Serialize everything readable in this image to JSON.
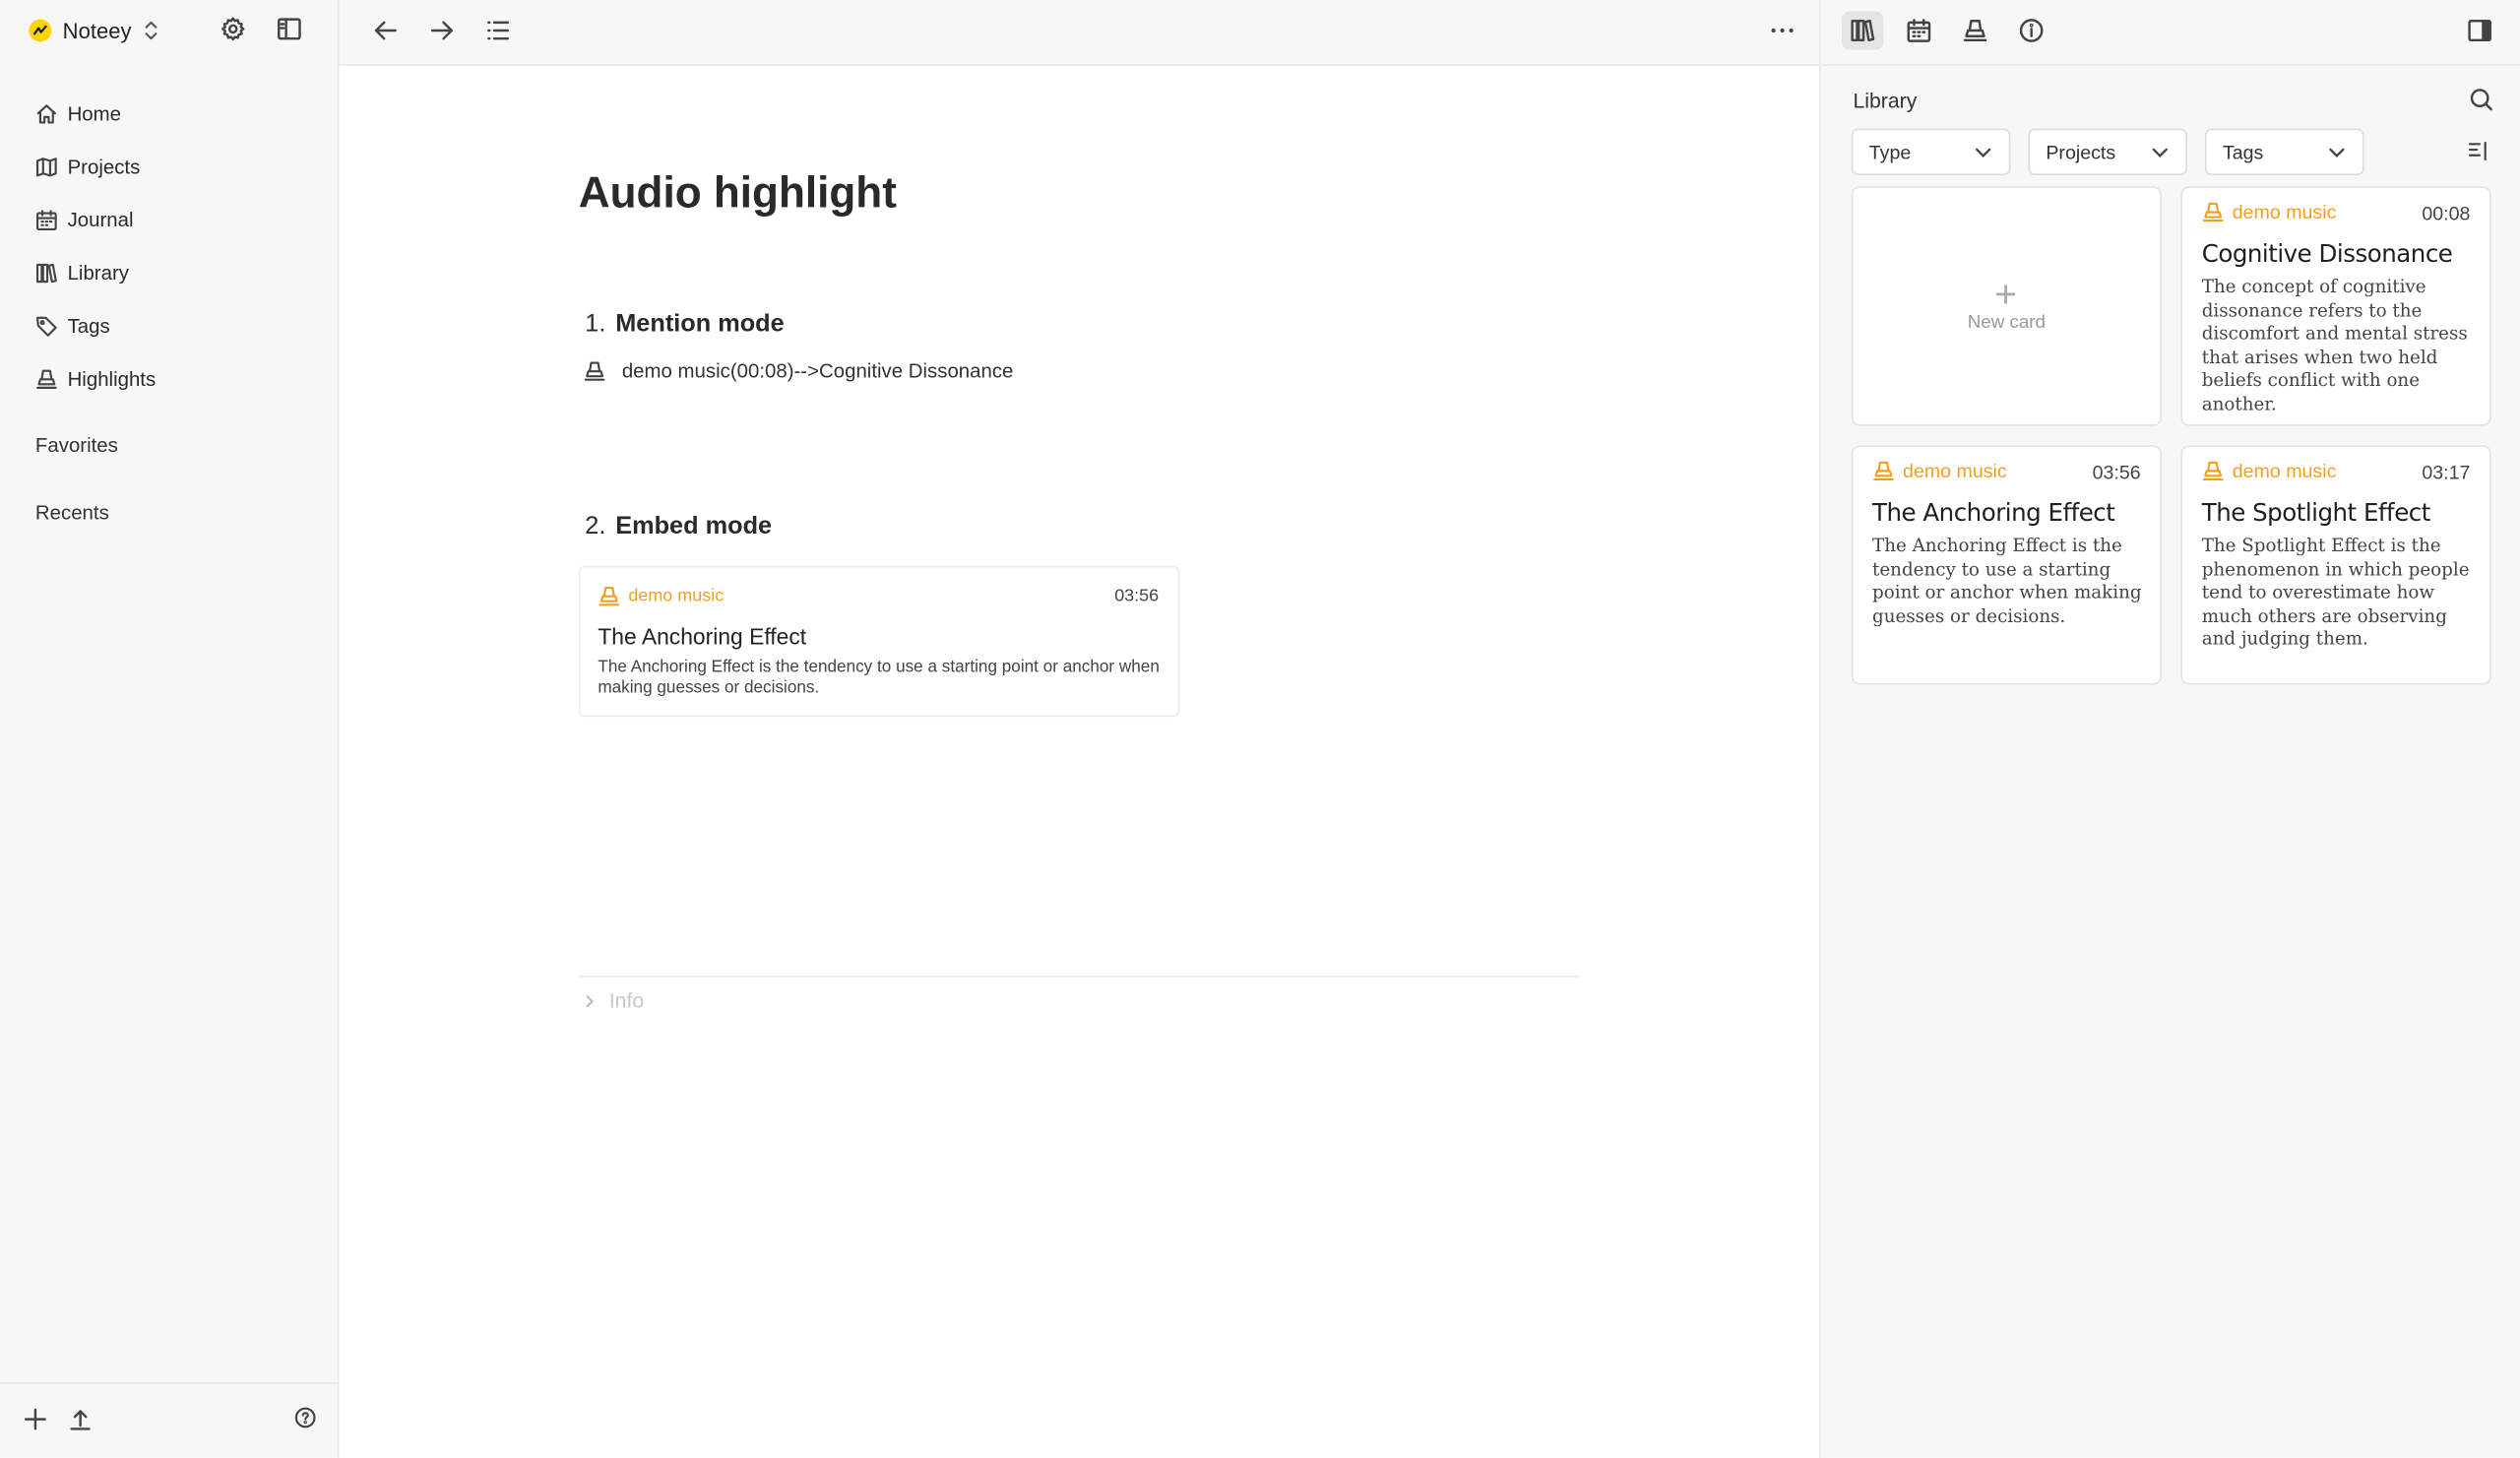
{
  "app": {
    "name": "Noteey"
  },
  "sidebar": {
    "items": [
      {
        "label": "Home",
        "icon": "home-icon"
      },
      {
        "label": "Projects",
        "icon": "map-icon"
      },
      {
        "label": "Journal",
        "icon": "calendar-icon"
      },
      {
        "label": "Library",
        "icon": "library-icon"
      },
      {
        "label": "Tags",
        "icon": "tag-icon"
      },
      {
        "label": "Highlights",
        "icon": "highlighter-icon"
      }
    ],
    "favorites_label": "Favorites",
    "recents_label": "Recents"
  },
  "document": {
    "title": "Audio highlight",
    "sections": [
      {
        "number": "1.",
        "heading": "Mention mode"
      },
      {
        "number": "2.",
        "heading": "Embed mode"
      }
    ],
    "mention_text": "demo music(00:08)-->Cognitive Dissonance",
    "embed": {
      "source": "demo music",
      "time": "03:56",
      "title": "The Anchoring Effect",
      "description": "The Anchoring Effect is the tendency to use a starting point or anchor when making guesses or decisions."
    },
    "info_label": "Info"
  },
  "library": {
    "title": "Library",
    "filters": [
      "Type",
      "Projects",
      "Tags"
    ],
    "new_card_label": "New card",
    "cards": [
      {
        "source": "demo music",
        "time": "00:08",
        "title": "Cognitive Dissonance",
        "description": "The concept of cognitive dissonance refers to the discomfort and mental stress that arises when two held beliefs conflict with one another."
      },
      {
        "source": "demo music",
        "time": "03:56",
        "title": "The Anchoring Effect",
        "description": "The Anchoring Effect is the tendency to use a starting point or anchor when making guesses or decisions."
      },
      {
        "source": "demo music",
        "time": "03:17",
        "title": "The Spotlight Effect",
        "description": "The Spotlight Effect is the phenomenon in which people tend to overestimate how much others are observing and judging them."
      }
    ]
  },
  "colors": {
    "accent": "#f0a020",
    "logo": "#ffd400"
  }
}
